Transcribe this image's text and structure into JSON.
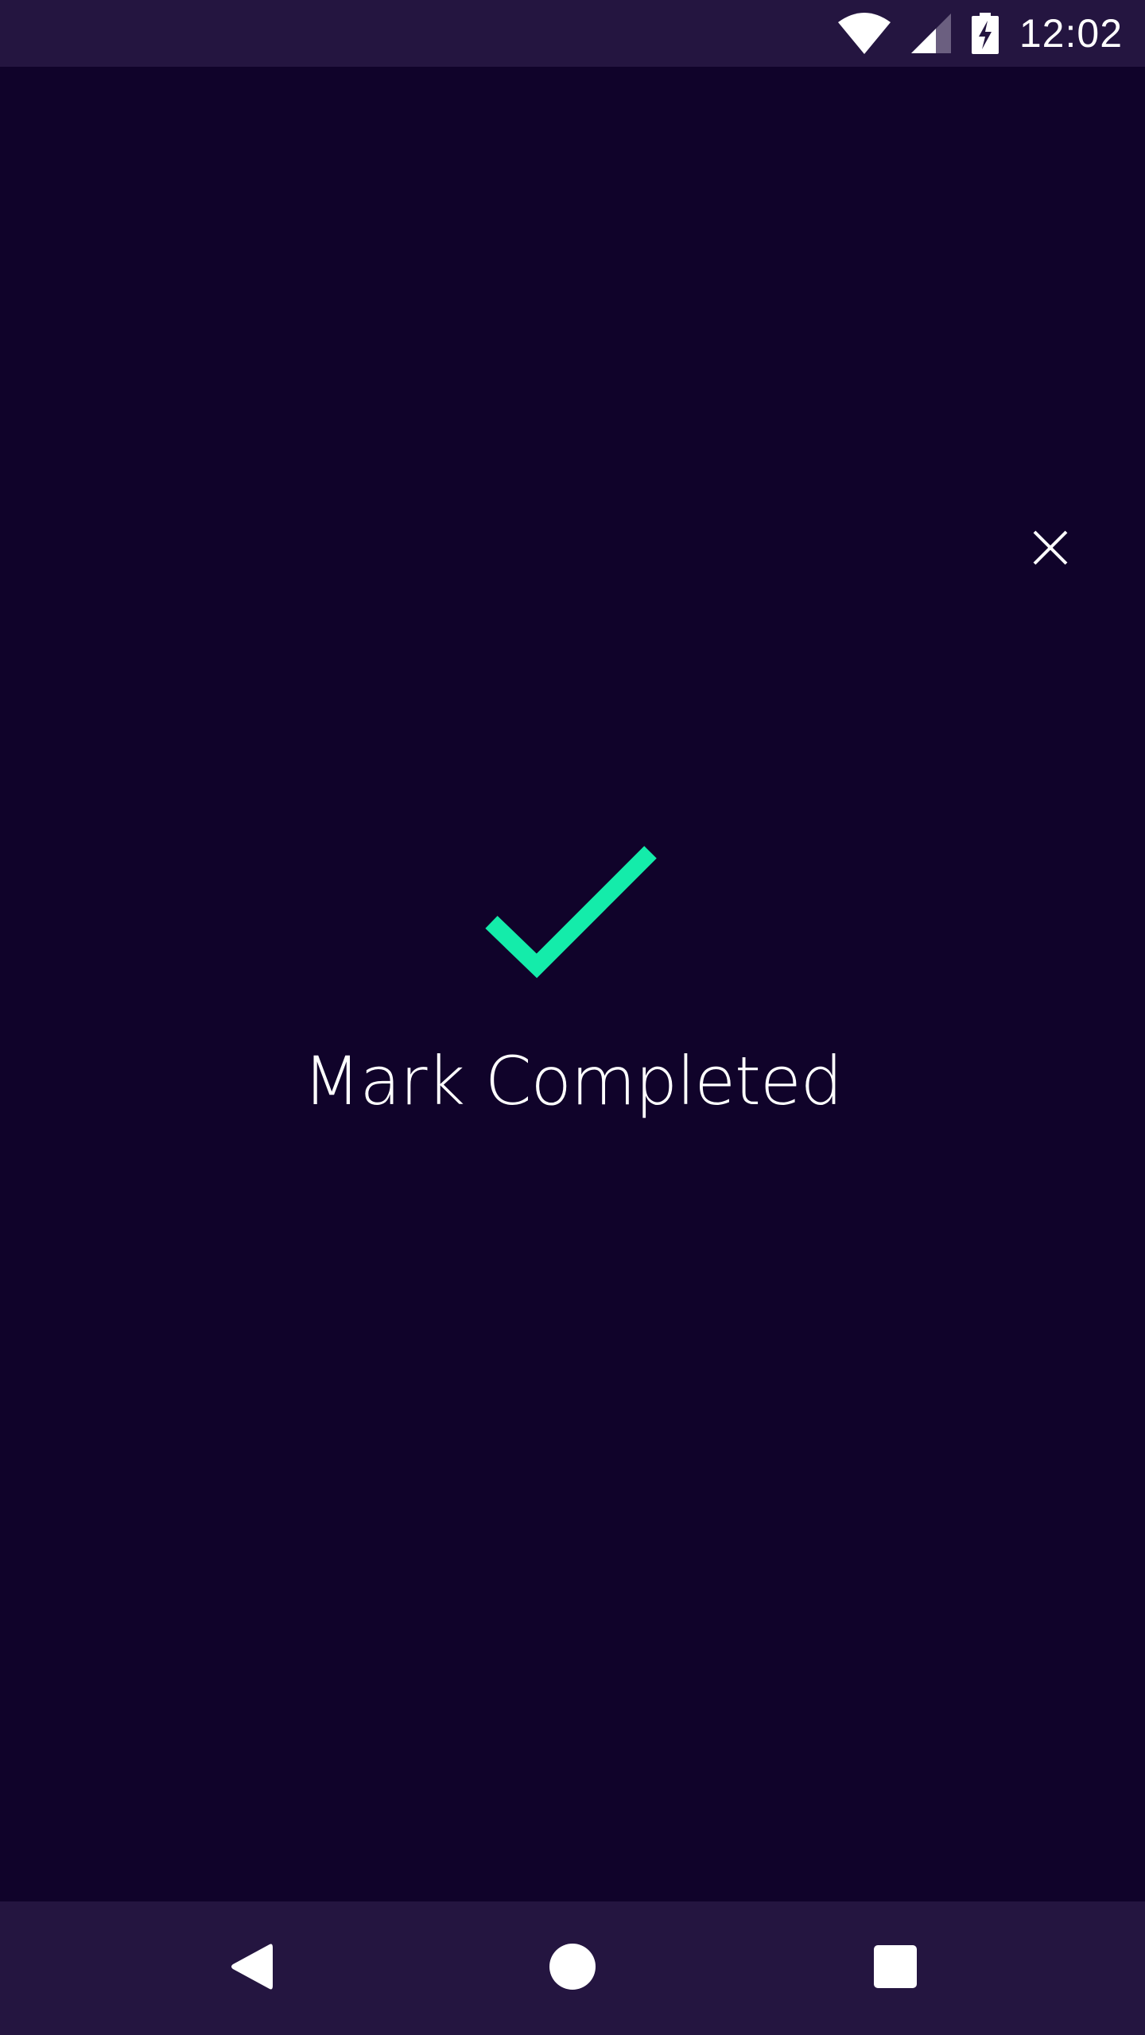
{
  "status_bar": {
    "time": "12:02",
    "icons": [
      "wifi-icon",
      "cell-signal-icon",
      "battery-charging-icon"
    ]
  },
  "dialog": {
    "close_icon": "close-icon",
    "check_icon": "checkmark-icon",
    "label": "Mark Completed"
  },
  "nav_bar": {
    "icons": [
      "back-icon",
      "home-icon",
      "recents-icon"
    ]
  },
  "colors": {
    "background": "#10032a",
    "bars": "#241540",
    "accent": "#14ecaa",
    "text": "#ffffff"
  }
}
